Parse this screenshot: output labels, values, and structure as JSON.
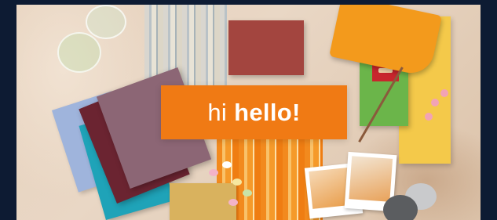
{
  "banner": {
    "greeting_regular": "hi",
    "greeting_bold": "hello!",
    "box_color": "#f07a14"
  },
  "colors": {
    "page_background": "#0d1b33",
    "sand": "#e7d2bd"
  }
}
